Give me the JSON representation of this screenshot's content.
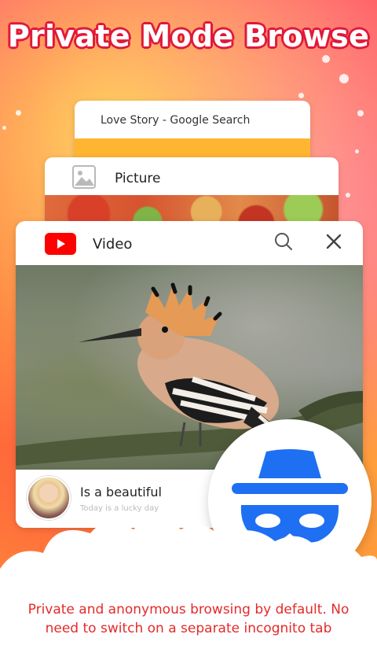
{
  "headline": "Private Mode Browse",
  "cards": {
    "search_tab": {
      "title": "Love Story - Google Search"
    },
    "picture_tab": {
      "title": "Picture",
      "icon": "image-icon"
    },
    "video_tab": {
      "title": "Video",
      "icon": "youtube-icon",
      "actions": [
        "search-icon",
        "close-icon"
      ],
      "post": {
        "title": "Is a beautiful",
        "subtitle": "Today is a lucky day"
      }
    }
  },
  "incognito_badge": {
    "icon": "incognito-icon",
    "color": "#1f6ff3"
  },
  "description": "Private and anonymous browsing by default. No need to switch on a separate incognito tab",
  "colors": {
    "headline_outline": "#e0193a",
    "accent_orange": "#ffb532",
    "description_text": "#e42a2a"
  }
}
